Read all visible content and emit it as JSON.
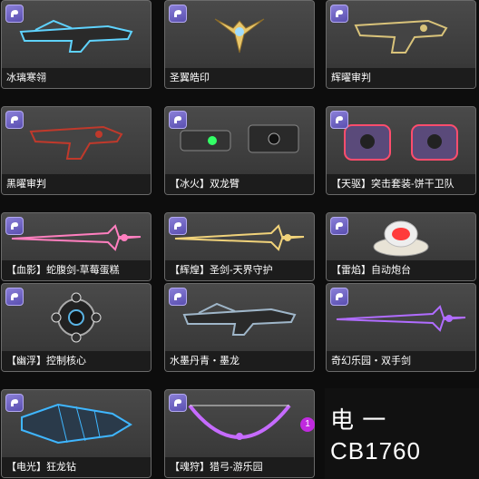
{
  "items": [
    {
      "label": "冰璃寒翎",
      "icon": "weapon-rifle-icon",
      "color": "#5fd3ff"
    },
    {
      "label": "圣翼皓印",
      "icon": "winged-emblem-icon",
      "color": "#e8c66a"
    },
    {
      "label": "辉曜审判",
      "icon": "weapon-pistol-icon",
      "color": "#d9c37a"
    },
    {
      "label": "黑曜审判",
      "icon": "weapon-pistol-icon",
      "color": "#c0392b"
    },
    {
      "label": "【冰火】双龙臂",
      "icon": "dual-arm-cannon-icon",
      "color": "#33ff66"
    },
    {
      "label": "【天驱】突击套装-饼干卫队",
      "icon": "turret-pair-icon",
      "color": "#ff4d6d"
    },
    {
      "label": "【血影】蛇腹剑-草莓蛋糕",
      "icon": "sword-icon",
      "color": "#ff7fbf"
    },
    {
      "label": "【辉煌】圣剑-天界守护",
      "icon": "sword-icon",
      "color": "#f0d27a"
    },
    {
      "label": "【雷焰】自动炮台",
      "icon": "auto-turret-icon",
      "color": "#ff3b3b"
    },
    {
      "label": "【幽浮】控制核心",
      "icon": "control-core-icon",
      "color": "#ffffff"
    },
    {
      "label": "水墨丹青・墨龙",
      "icon": "weapon-rifle-icon",
      "color": "#9fb6c9"
    },
    {
      "label": "奇幻乐园・双手剑",
      "icon": "sword-icon",
      "color": "#b06cff"
    },
    {
      "label": "【电光】狂龙钻",
      "icon": "drill-weapon-icon",
      "color": "#3fb6ff"
    },
    {
      "label": "【魂狩】猎弓-游乐园",
      "icon": "bow-icon",
      "color": "#c66bff"
    }
  ],
  "overlay": {
    "line1": "电 一",
    "line2": "CB1760",
    "notif_count": "1"
  }
}
